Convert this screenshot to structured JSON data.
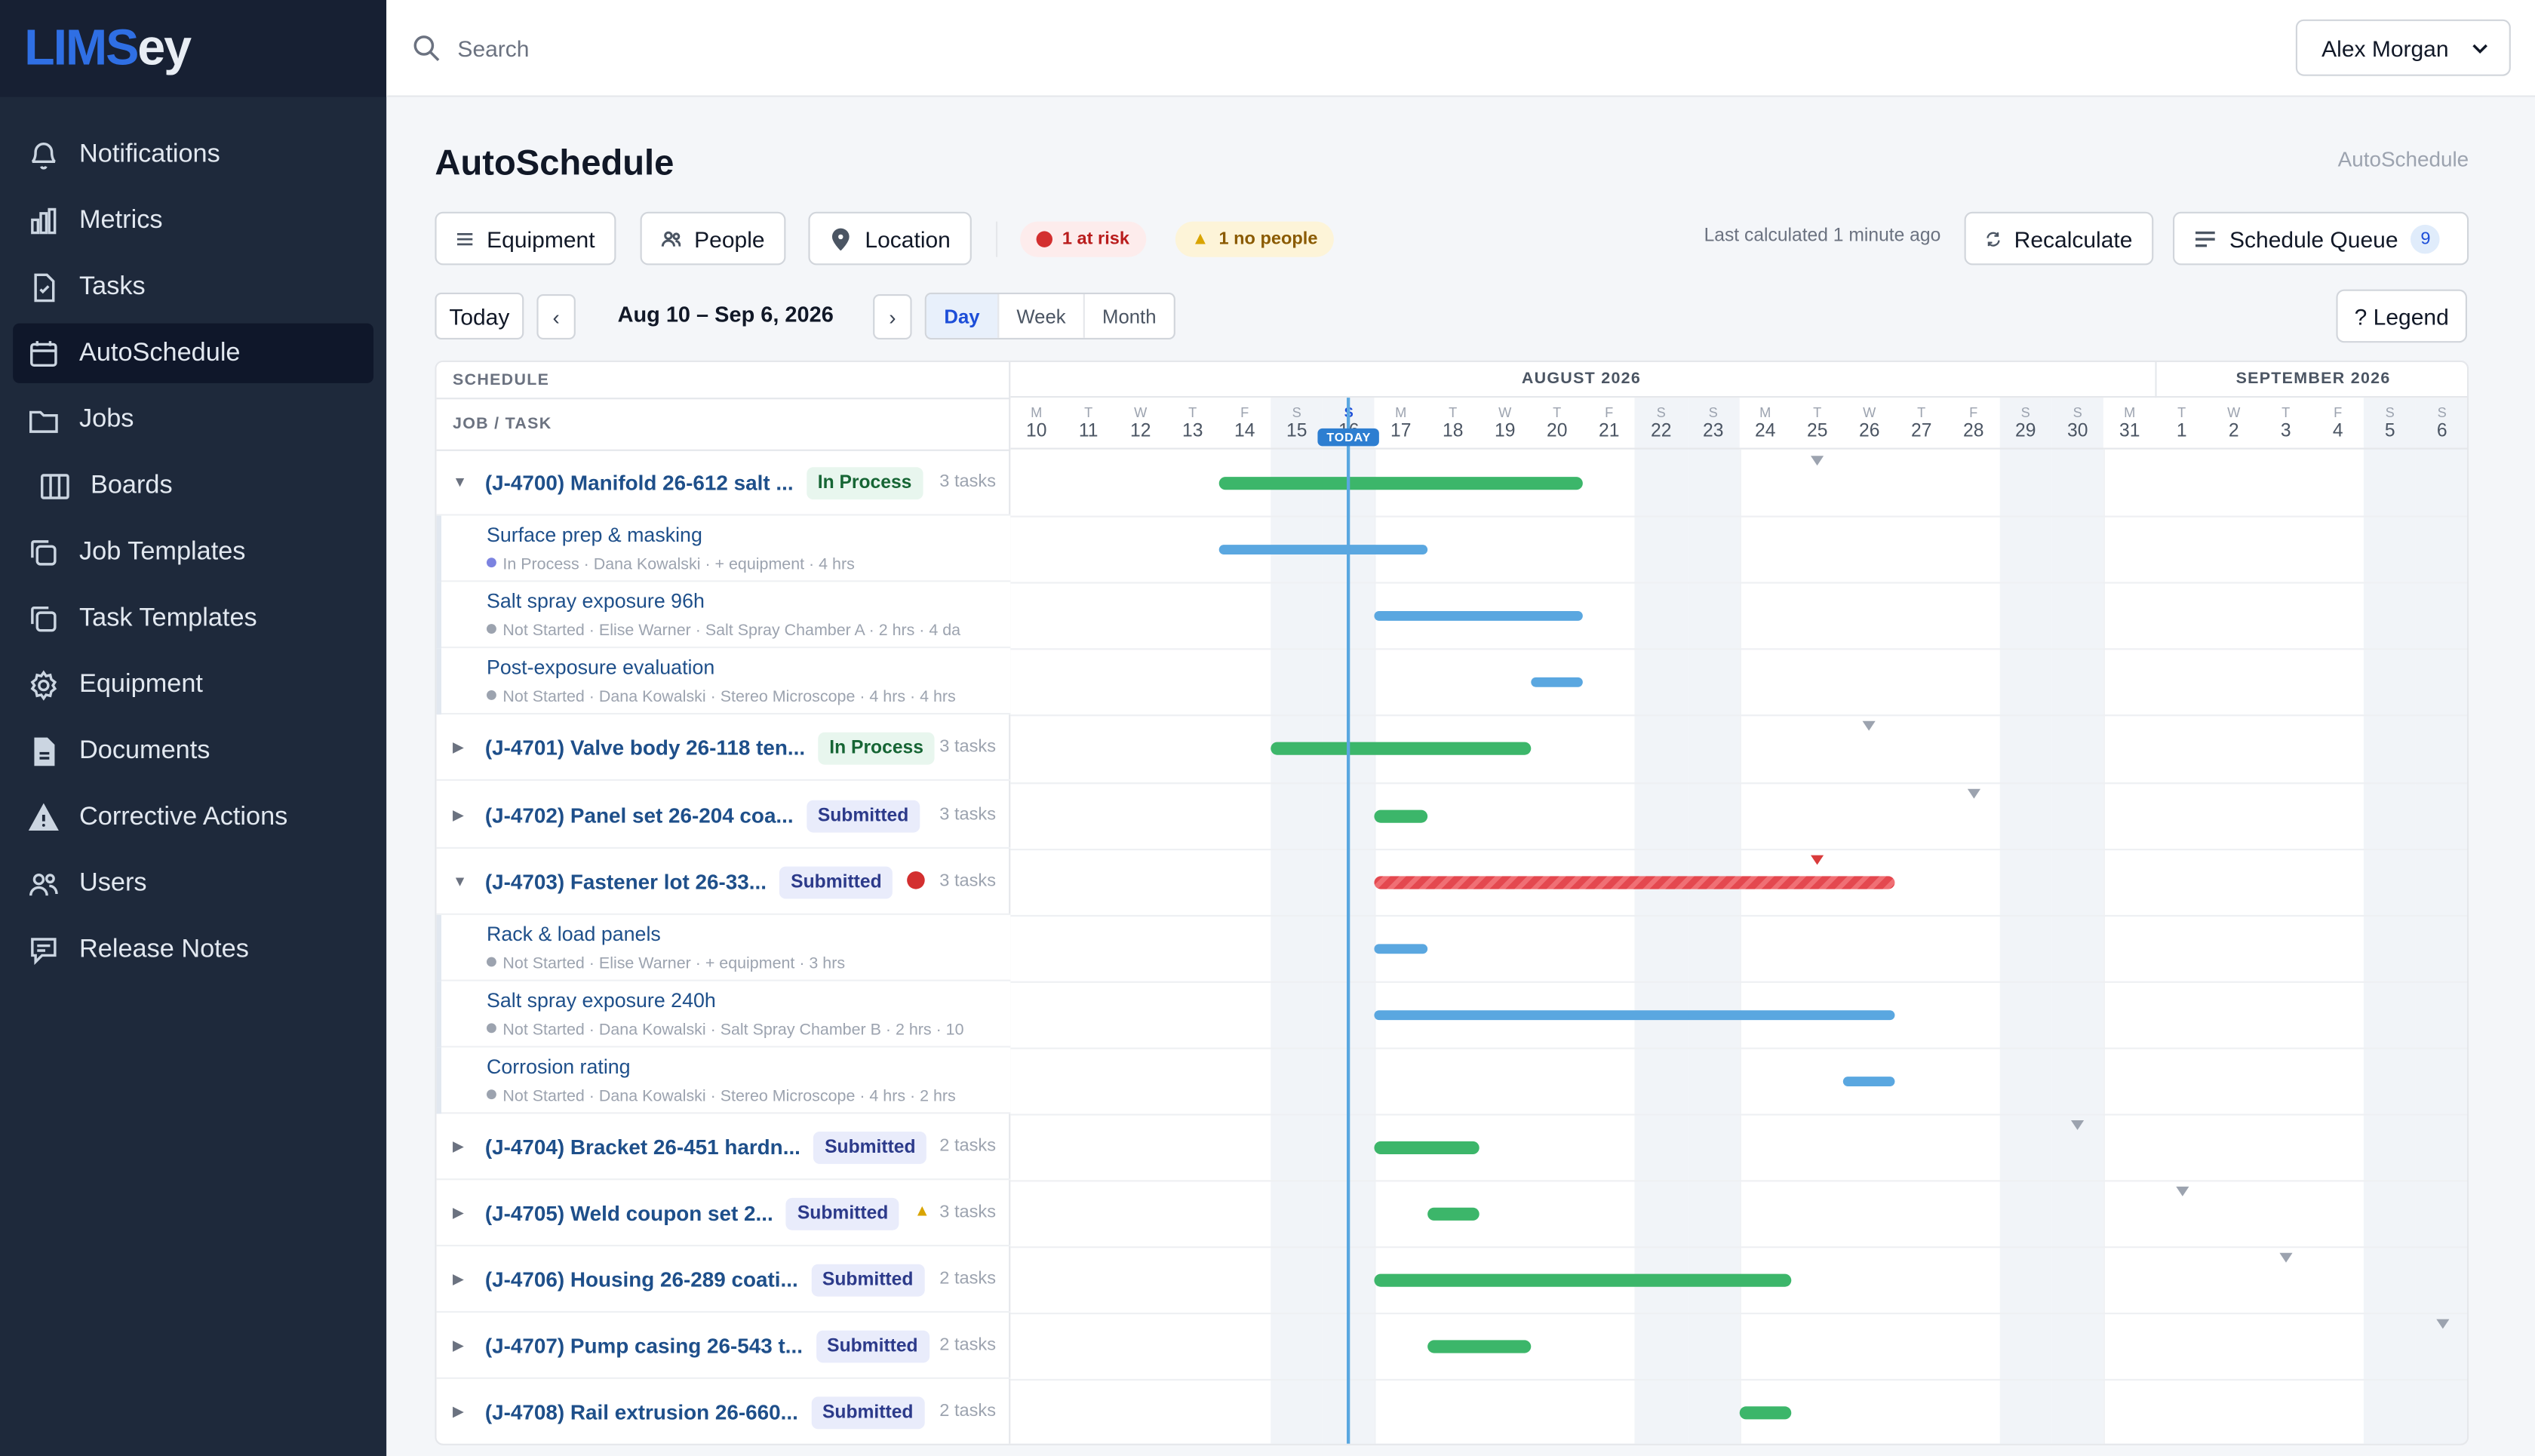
{
  "brand": {
    "part1": "LIMS",
    "part2": "ey"
  },
  "sidebar": {
    "items": [
      {
        "label": "Notifications",
        "icon": "bell-icon"
      },
      {
        "label": "Metrics",
        "icon": "bar-chart-icon"
      },
      {
        "label": "Tasks",
        "icon": "checklist-file-icon"
      },
      {
        "label": "AutoSchedule",
        "icon": "calendar-icon",
        "active": true
      },
      {
        "label": "Jobs",
        "icon": "folder-icon"
      },
      {
        "label": "Boards",
        "icon": "columns-icon",
        "sub": true
      },
      {
        "label": "Job Templates",
        "icon": "copy-icon"
      },
      {
        "label": "Task Templates",
        "icon": "copy-icon"
      },
      {
        "label": "Equipment",
        "icon": "gear-icon"
      },
      {
        "label": "Documents",
        "icon": "document-icon"
      },
      {
        "label": "Corrective Actions",
        "icon": "warning-icon"
      },
      {
        "label": "Users",
        "icon": "users-icon"
      },
      {
        "label": "Release Notes",
        "icon": "message-icon"
      }
    ]
  },
  "topbar": {
    "search_placeholder": "Search",
    "user": "Alex Morgan"
  },
  "page": {
    "title": "AutoSchedule",
    "breadcrumb": "AutoSchedule"
  },
  "toolbar": {
    "equipment": "Equipment",
    "people": "People",
    "location": "Location",
    "at_risk": "1 at risk",
    "no_people": "1 no people",
    "last_calculated": "Last calculated 1 minute ago",
    "recalculate": "Recalculate",
    "queue": "Schedule Queue",
    "queue_count": "9",
    "today": "Today",
    "prev": "‹",
    "next": "›",
    "range": "Aug 10 – Sep 6, 2026",
    "views": [
      "Day",
      "Week",
      "Month"
    ],
    "active_view": "Day",
    "legend": "? Legend"
  },
  "grid": {
    "schedule_label": "SCHEDULE",
    "job_task_label": "JOB / TASK",
    "months": [
      {
        "label": "AUGUST 2026"
      },
      {
        "label": "SEPTEMBER 2026"
      }
    ],
    "today_label": "TODAY",
    "days": [
      {
        "l": "M",
        "n": "10"
      },
      {
        "l": "T",
        "n": "11"
      },
      {
        "l": "W",
        "n": "12"
      },
      {
        "l": "T",
        "n": "13"
      },
      {
        "l": "F",
        "n": "14"
      },
      {
        "l": "S",
        "n": "15",
        "we": true
      },
      {
        "l": "S",
        "n": "16",
        "we": true,
        "today": true
      },
      {
        "l": "M",
        "n": "17"
      },
      {
        "l": "T",
        "n": "18"
      },
      {
        "l": "W",
        "n": "19"
      },
      {
        "l": "T",
        "n": "20"
      },
      {
        "l": "F",
        "n": "21"
      },
      {
        "l": "S",
        "n": "22",
        "we": true
      },
      {
        "l": "S",
        "n": "23",
        "we": true
      },
      {
        "l": "M",
        "n": "24"
      },
      {
        "l": "T",
        "n": "25"
      },
      {
        "l": "W",
        "n": "26"
      },
      {
        "l": "T",
        "n": "27"
      },
      {
        "l": "F",
        "n": "28"
      },
      {
        "l": "S",
        "n": "29",
        "we": true
      },
      {
        "l": "S",
        "n": "30",
        "we": true
      },
      {
        "l": "M",
        "n": "31"
      },
      {
        "l": "T",
        "n": "1"
      },
      {
        "l": "W",
        "n": "2"
      },
      {
        "l": "T",
        "n": "3"
      },
      {
        "l": "F",
        "n": "4"
      },
      {
        "l": "S",
        "n": "5",
        "we": true
      },
      {
        "l": "S",
        "n": "6",
        "we": true
      }
    ],
    "rows": [
      {
        "type": "job",
        "open": true,
        "name": "(J-4700) Manifold 26-612 salt ...",
        "status": "In Process",
        "tasks": "3 tasks",
        "bar": [
          4,
          11
        ],
        "due": 15.5
      },
      {
        "type": "task",
        "name": "Surface prep & masking",
        "status": "In Process",
        "dot": "#7c83e0",
        "meta": [
          "Dana Kowalski",
          "+ equipment",
          "4 hrs"
        ],
        "bar": [
          4,
          8
        ]
      },
      {
        "type": "task",
        "name": "Salt spray exposure 96h",
        "status": "Not Started",
        "dot": "#9ca3af",
        "meta": [
          "Elise Warner",
          "Salt Spray Chamber A",
          "2 hrs · 4 da"
        ],
        "bar": [
          7,
          11
        ]
      },
      {
        "type": "task",
        "name": "Post-exposure evaluation",
        "status": "Not Started",
        "dot": "#9ca3af",
        "meta": [
          "Dana Kowalski",
          "Stereo Microscope",
          "4 hrs · 4 hrs"
        ],
        "bar": [
          10,
          11
        ]
      },
      {
        "type": "job",
        "open": false,
        "name": "(J-4701) Valve body 26-118 ten...",
        "status": "In Process",
        "tasks": "3 tasks",
        "bar": [
          5,
          10
        ],
        "due": 16.5
      },
      {
        "type": "job",
        "open": false,
        "name": "(J-4702) Panel set 26-204 coa...",
        "status": "Submitted",
        "tasks": "3 tasks",
        "bar": [
          7,
          8
        ],
        "due": 18.5
      },
      {
        "type": "job",
        "open": true,
        "name": "(J-4703) Fastener lot 26-33...",
        "status": "Submitted",
        "tasks": "3 tasks",
        "flag": "risk",
        "bar": [
          7,
          17
        ],
        "red": true,
        "due": 15.5,
        "dueRed": true
      },
      {
        "type": "task",
        "name": "Rack & load panels",
        "status": "Not Started",
        "dot": "#9ca3af",
        "meta": [
          "Elise Warner",
          "+ equipment",
          "3 hrs"
        ],
        "bar": [
          7,
          8
        ]
      },
      {
        "type": "task",
        "name": "Salt spray exposure 240h",
        "status": "Not Started",
        "dot": "#9ca3af",
        "meta": [
          "Dana Kowalski",
          "Salt Spray Chamber B",
          "2 hrs · 10"
        ],
        "bar": [
          7,
          17
        ]
      },
      {
        "type": "task",
        "name": "Corrosion rating",
        "status": "Not Started",
        "dot": "#9ca3af",
        "meta": [
          "Dana Kowalski",
          "Stereo Microscope",
          "4 hrs · 2 hrs"
        ],
        "bar": [
          16,
          17
        ]
      },
      {
        "type": "job",
        "open": false,
        "name": "(J-4704) Bracket 26-451 hardn...",
        "status": "Submitted",
        "tasks": "2 tasks",
        "bar": [
          7,
          9
        ],
        "due": 20.5
      },
      {
        "type": "job",
        "open": false,
        "name": "(J-4705) Weld coupon set 2...",
        "status": "Submitted",
        "tasks": "3 tasks",
        "flag": "people",
        "bar": [
          8,
          9
        ],
        "due": 22.5
      },
      {
        "type": "job",
        "open": false,
        "name": "(J-4706) Housing 26-289 coati...",
        "status": "Submitted",
        "tasks": "2 tasks",
        "bar": [
          7,
          15
        ],
        "due": 24.5
      },
      {
        "type": "job",
        "open": false,
        "name": "(J-4707) Pump casing 26-543 t...",
        "status": "Submitted",
        "tasks": "2 tasks",
        "bar": [
          8,
          10
        ],
        "due": 27.5
      },
      {
        "type": "job",
        "open": false,
        "name": "(J-4708) Rail extrusion 26-660...",
        "status": "Submitted",
        "tasks": "2 tasks",
        "bar": [
          14,
          15
        ]
      }
    ]
  },
  "colors": {
    "accent": "#2f6fe4",
    "green": "#3cb66a",
    "blue": "#5aa7e0",
    "red": "#e4484f"
  }
}
